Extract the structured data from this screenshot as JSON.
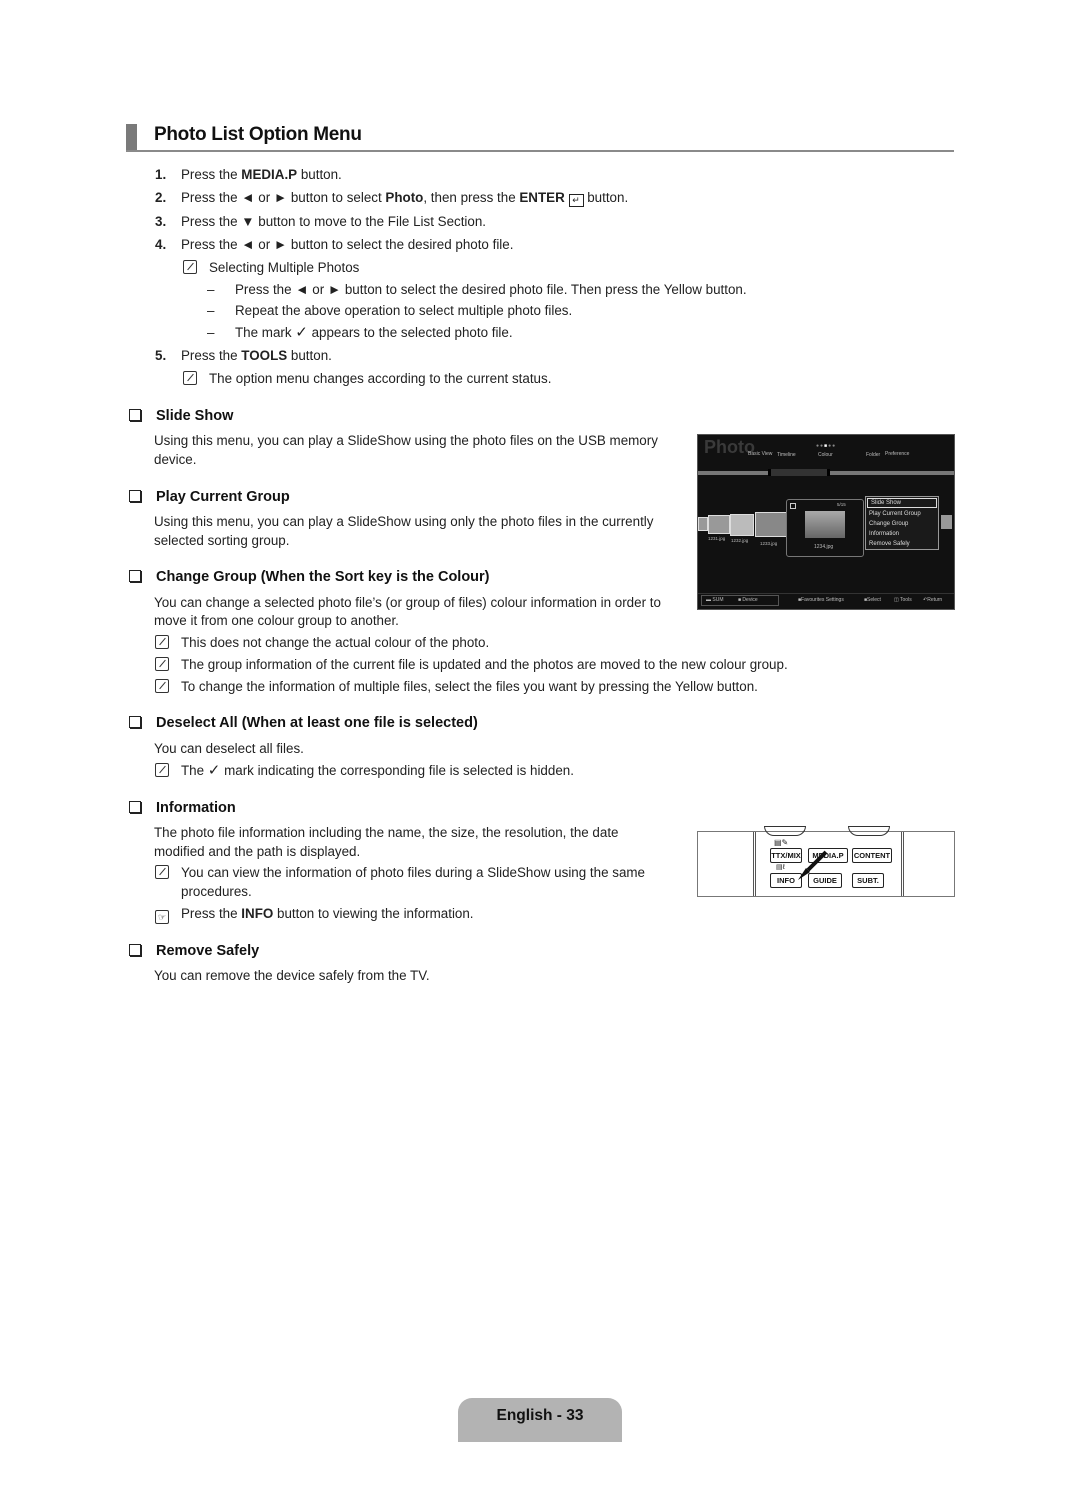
{
  "page": {
    "title": "Photo List Option Menu",
    "footer": "English - 33"
  },
  "steps": [
    {
      "num": "1.",
      "pre": "Press the ",
      "bold": "MEDIA.P",
      "post": " button."
    },
    {
      "num": "2.",
      "pre": "Press the ◄ or ► button to select ",
      "bold": "Photo",
      "mid": ", then press the ",
      "bold2": "ENTER",
      "post": " button."
    },
    {
      "num": "3.",
      "text": "Press the ▼ button to move to the File List Section."
    },
    {
      "num": "4.",
      "text": "Press the ◄ or ► button to select the desired photo file."
    },
    {
      "num": "5.",
      "pre": "Press the ",
      "bold": "TOOLS",
      "post": " button."
    }
  ],
  "step4_note": "Selecting Multiple Photos",
  "step4_dashes": [
    "Press the ◄ or ► button to select the desired photo file. Then press the Yellow button.",
    "Repeat the above operation to select multiple photo files.",
    {
      "pre": "The mark ",
      "post": " appears to the selected photo file."
    }
  ],
  "step5_note": "The option menu changes according to the current status.",
  "sections": {
    "slide_show": {
      "heading": "Slide Show",
      "lines": [
        "Using this menu, you can play a SlideShow using the photo files on the USB memory",
        "device."
      ]
    },
    "play_current_group": {
      "heading": "Play Current Group",
      "lines": [
        "Using this menu, you can play a SlideShow using only the photo files in the currently",
        "selected sorting group."
      ]
    },
    "change_group": {
      "heading": "Change Group (When the Sort key is the Colour)",
      "lines": [
        "You can change a selected photo file’s (or group of files) colour information in order to",
        "move it from one colour group to another."
      ],
      "notes": [
        "This does not change the actual colour of the photo.",
        "The group information of the current file is updated and the photos are moved to the new colour group.",
        "To change the information of multiple files, select the files you want by pressing the Yellow button."
      ]
    },
    "deselect_all": {
      "heading": "Deselect All (When at least one file is selected)",
      "lines": [
        "You can deselect all files."
      ],
      "note_pre": "The ",
      "note_post": " mark indicating the corresponding file is selected is hidden."
    },
    "information": {
      "heading": "Information",
      "lines": [
        "The photo file information including the name, the size, the resolution, the date",
        "modified and the path is displayed."
      ],
      "note": [
        "You can view the information of photo files during a SlideShow using the same",
        "procedures."
      ],
      "tip_pre": "Press the ",
      "tip_bold": "INFO",
      "tip_post": " button to viewing the information."
    },
    "remove_safely": {
      "heading": "Remove Safely",
      "lines": [
        "You can remove the device safely from the TV."
      ]
    }
  },
  "tv_screen": {
    "title": "Photo",
    "sort_tabs": [
      "Basic View",
      "Timeline",
      "Colour",
      "Folder",
      "Preference"
    ],
    "thumbnails": [
      "1231.jpg",
      "1232.jpg",
      "1233.jpg"
    ],
    "current_file": "1234.jpg",
    "counter": "5/15",
    "menu_items": [
      "Slide Show",
      "Play Current Group",
      "Change Group",
      "Information",
      "Remove Safely"
    ],
    "selected_menu_item": "Slide Show",
    "footer_left": [
      "SUM",
      "Device"
    ],
    "footer_right": [
      "Favourites Settings",
      "Select",
      "Tools",
      "Return"
    ]
  },
  "remote": {
    "buttons_row1": [
      "TTX/MIX",
      "MEDIA.P",
      "CONTENT"
    ],
    "buttons_row2": [
      "INFO",
      "GUIDE",
      "SUBT."
    ]
  }
}
